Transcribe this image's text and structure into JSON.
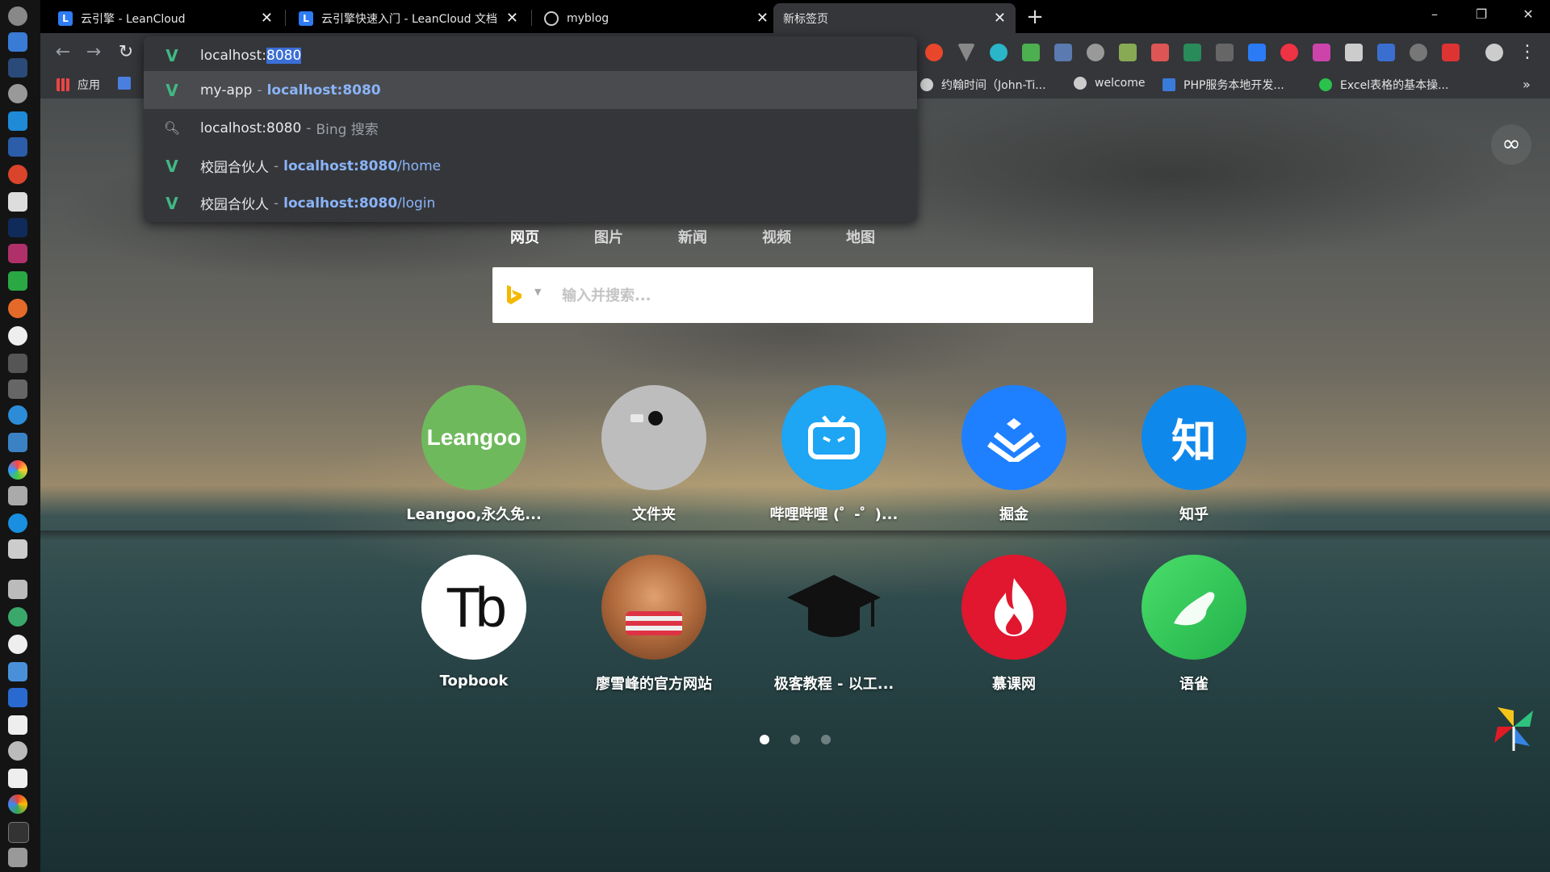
{
  "tabs": [
    {
      "title": "云引擎 - LeanCloud",
      "favicon": "L",
      "color": "#2e7cf6"
    },
    {
      "title": "云引擎快速入门 - LeanCloud 文档",
      "favicon": "L",
      "color": "#2e7cf6"
    },
    {
      "title": "myblog",
      "favicon": "",
      "color": "#444"
    },
    {
      "title": "新标签页",
      "favicon": "",
      "color": "",
      "active": true
    }
  ],
  "omnibox": {
    "typed": "localhost:",
    "selected": "8080",
    "suggestions": [
      {
        "icon": "vue-icon",
        "title": "my-app",
        "url_bold": "localhost:8080",
        "url_rest": "",
        "selected": true
      },
      {
        "icon": "search-icon",
        "title": "localhost:8080",
        "hint": "Bing 搜索"
      },
      {
        "icon": "vue-icon",
        "title": "校园合伙人",
        "url_bold": "localhost:8080",
        "url_rest": "/home"
      },
      {
        "icon": "vue-icon",
        "title": "校园合伙人",
        "url_bold": "localhost:8080",
        "url_rest": "/login"
      }
    ]
  },
  "bookmarks": [
    {
      "label": "应用",
      "icon": "apps-icon"
    },
    {
      "label": "约翰时间（John-Ti...",
      "icon": "globe-icon"
    },
    {
      "label": "welcome",
      "icon": "globe-icon"
    },
    {
      "label": "PHP服务本地开发...",
      "icon": "php-icon"
    },
    {
      "label": "Excel表格的基本操...",
      "icon": "wechat-icon"
    }
  ],
  "bookmarks_more": "»",
  "search": {
    "tabs": [
      "网页",
      "图片",
      "新闻",
      "视频",
      "地图"
    ],
    "active_tab": "网页",
    "placeholder": "输入并搜索...",
    "engine_icon": "bing-icon"
  },
  "sites": [
    {
      "label": "Leangoo,永久免...",
      "logo_text": "Leangoo",
      "color": "#6fb95d"
    },
    {
      "label": "文件夹",
      "logo_text": "",
      "color": "#bdbdbd"
    },
    {
      "label": "哔哩哔哩 (゜-゜)...",
      "logo_text": "",
      "color": "#1ea5f4"
    },
    {
      "label": "掘金",
      "logo_text": "",
      "color": "#1e80ff"
    },
    {
      "label": "知乎",
      "logo_text": "知",
      "color": "#0f88eb"
    },
    {
      "label": "Topbook",
      "logo_text": "Tb",
      "color": "#ffffff"
    },
    {
      "label": "廖雪峰的官方网站",
      "logo_text": "",
      "color": "#b57a4a"
    },
    {
      "label": "极客教程 - 以工...",
      "logo_text": "",
      "color": "transparent"
    },
    {
      "label": "慕课网",
      "logo_text": "",
      "color": "#e0172f"
    },
    {
      "label": "语雀",
      "logo_text": "",
      "color": "#3ec85a"
    }
  ],
  "pages": {
    "count": 3,
    "current": 1
  },
  "window_controls": {
    "minimize": "–",
    "maximize": "❐",
    "close": "✕"
  },
  "new_tab_symbol": "+",
  "infinity_symbol": "∞"
}
